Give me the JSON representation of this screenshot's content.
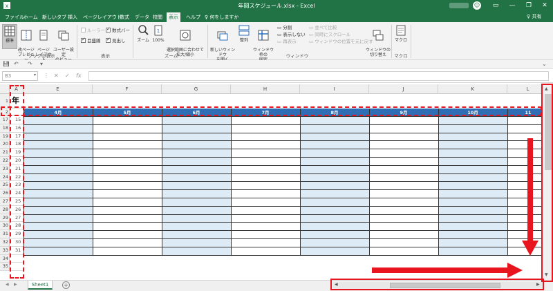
{
  "window": {
    "title": "年間スケジュール.xlsx  -  Excel",
    "minimize": "—",
    "restore": "❐",
    "close": "✕",
    "share": "♀ 共有"
  },
  "tabs": [
    "ファイル",
    "ホーム",
    "新しいタブ",
    "挿入",
    "ページレイアウト",
    "数式",
    "データ",
    "校閲",
    "表示",
    "ヘルプ",
    "♀ 何をしますか"
  ],
  "active_tab": "表示",
  "ribbon": {
    "normal": "標準",
    "page_break": "改ページ\nプレビュー",
    "page_layout": "ページ\nレイアウト",
    "custom_view": "ユーザー設定\nのビュー",
    "group_book_views": "ブックの表示",
    "ruler": "ルーラー",
    "formula_bar": "数式バー",
    "gridlines": "目盛線",
    "headings": "見出し",
    "group_show": "表示",
    "zoom": "ズーム",
    "zoom_100": "100%",
    "zoom_selection": "選択範囲に合わせて\n拡大/縮小",
    "group_zoom": "ズーム",
    "new_window": "新しいウィンドウ\nを開く",
    "arrange": "整列",
    "freeze": "ウィンドウ枠の\n固定",
    "split": "分割",
    "hide": "表示しない",
    "unhide": "再表示",
    "side_by_side": "並べて比較",
    "sync_scroll": "同時にスクロール",
    "reset_pos": "ウィンドウの位置を元に戻す",
    "group_window": "ウィンドウ",
    "switch_windows": "ウィンドウの\n切り替え",
    "macros": "マクロ",
    "group_macro": "マクロ"
  },
  "formula": {
    "namebox": "B3",
    "cancel": "✕",
    "enter": "✓",
    "fx": "fx"
  },
  "grid": {
    "columns": [
      "A",
      "E",
      "F",
      "G",
      "H",
      "I",
      "J",
      "K",
      "L"
    ],
    "title_fragment": "年",
    "months": [
      "4月",
      "5月",
      "6月",
      "7月",
      "8月",
      "9月",
      "10月",
      "11"
    ],
    "row_numbers": [
      "1",
      "2",
      "17",
      "18",
      "19",
      "20",
      "21",
      "22",
      "23",
      "24",
      "25",
      "26",
      "27",
      "28",
      "29",
      "30",
      "31",
      "32",
      "33",
      "34",
      "35"
    ],
    "a_values": [
      "",
      "",
      "15",
      "16",
      "17",
      "18",
      "19",
      "20",
      "21",
      "22",
      "23",
      "24",
      "25",
      "26",
      "27",
      "28",
      "29",
      "30",
      "31",
      "",
      ""
    ]
  },
  "sheet": {
    "tab": "Sheet1",
    "add": "+"
  }
}
